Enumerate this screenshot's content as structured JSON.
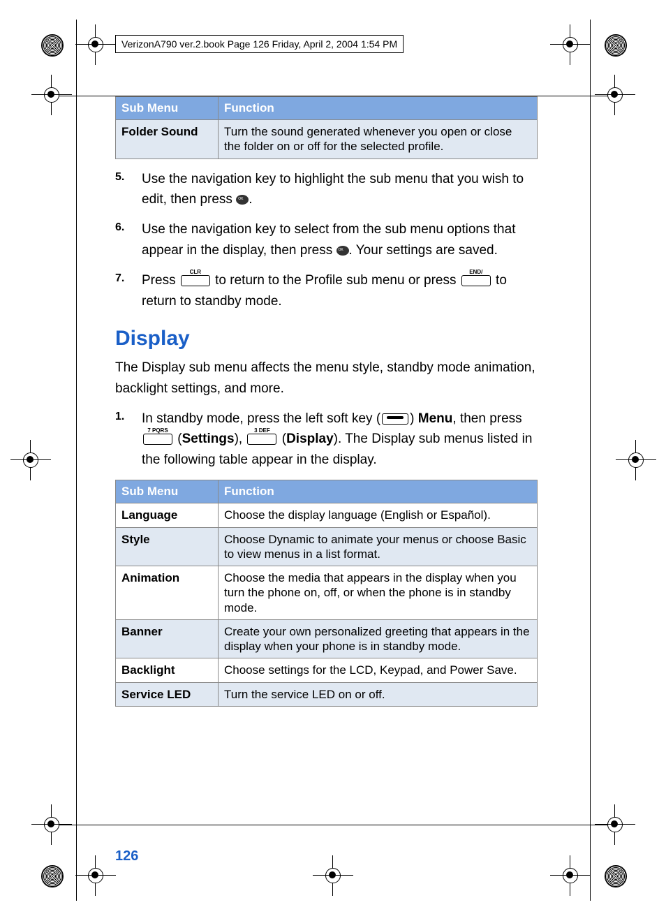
{
  "header": {
    "text": "VerizonA790 ver.2.book  Page 126  Friday, April 2, 2004  1:54 PM"
  },
  "table1": {
    "headers": [
      "Sub Menu",
      "Function"
    ],
    "rows": [
      {
        "label": "Folder Sound",
        "func": "Turn the sound generated whenever you open or close the folder on or off for the selected profile."
      }
    ]
  },
  "steps_a": [
    {
      "num": "5.",
      "pre": "Use the navigation key to highlight the sub menu that you wish to edit, then press ",
      "post": "."
    },
    {
      "num": "6.",
      "pre": "Use the navigation key to select from the sub menu options that appear in the display, then press ",
      "post": ". Your settings are saved."
    },
    {
      "num": "7.",
      "pre": "Press ",
      "mid": " to return to the Profile sub menu or press ",
      "post": " to return to standby mode."
    }
  ],
  "section": {
    "title": "Display",
    "intro": "The Display sub menu affects the menu style, standby mode animation, backlight settings, and more."
  },
  "steps_b": [
    {
      "num": "1.",
      "t1": "In standby mode, press the left soft key (",
      "t2": ") ",
      "menu": "Menu",
      "t3": ", then press ",
      "t4": " (",
      "settings": "Settings",
      "t5": "), ",
      "t6": " (",
      "display": "Display",
      "t7": "). The Display sub menus listed in the following table appear in the display."
    }
  ],
  "table2": {
    "headers": [
      "Sub Menu",
      "Function"
    ],
    "rows": [
      {
        "label": "Language",
        "func": "Choose the display language (English or Español)."
      },
      {
        "label": "Style",
        "func": "Choose Dynamic to animate your menus or choose Basic to view menus in a list format."
      },
      {
        "label": "Animation",
        "func": "Choose the media that appears in the display when you turn the phone on, off, or when the phone is in standby mode."
      },
      {
        "label": "Banner",
        "func": "Create your own personalized greeting that appears in the display when your phone is in standby mode."
      },
      {
        "label": "Backlight",
        "func": "Choose settings for the LCD, Keypad, and Power Save."
      },
      {
        "label": "Service LED",
        "func": "Turn the service LED on or off."
      }
    ]
  },
  "keys": {
    "clr": "CLR",
    "end": "END/",
    "k7": "7 PQRS",
    "k3": "3 DEF"
  },
  "page_number": "126"
}
